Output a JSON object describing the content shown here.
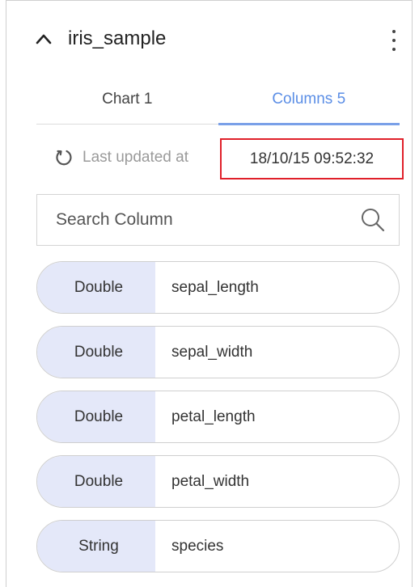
{
  "header": {
    "title": "iris_sample"
  },
  "tabs": [
    {
      "label": "Chart 1",
      "active": false
    },
    {
      "label": "Columns 5",
      "active": true
    }
  ],
  "status": {
    "label": "Last updated at",
    "timestamp": "18/10/15 09:52:32"
  },
  "search": {
    "placeholder": "Search Column"
  },
  "columns": [
    {
      "type": "Double",
      "name": "sepal_length"
    },
    {
      "type": "Double",
      "name": "sepal_width"
    },
    {
      "type": "Double",
      "name": "petal_length"
    },
    {
      "type": "Double",
      "name": "petal_width"
    },
    {
      "type": "String",
      "name": "species"
    }
  ],
  "colors": {
    "accent": "#5b8ee6",
    "badge_bg": "#e4e8f9",
    "highlight_border": "#e0202a"
  },
  "icons": {
    "collapse": "chevron-up-icon",
    "more": "more-vertical-icon",
    "refresh": "refresh-icon",
    "search": "search-icon"
  }
}
